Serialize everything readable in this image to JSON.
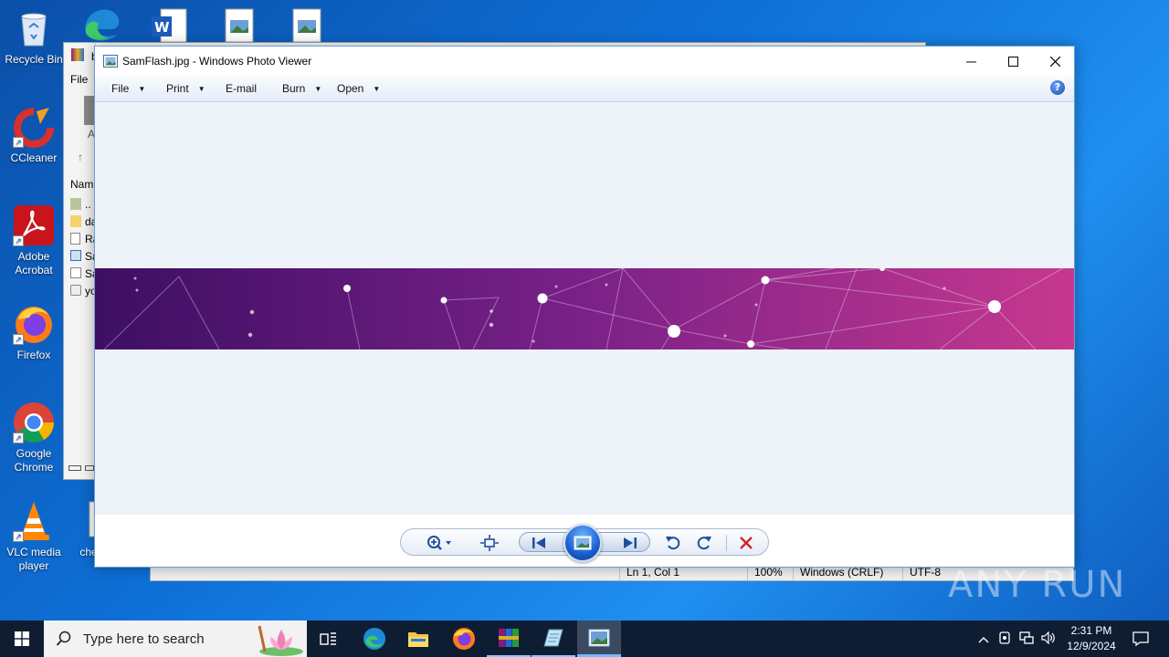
{
  "desktop": {
    "icons": [
      {
        "label": "Recycle Bin"
      },
      {
        "label": "CCleaner"
      },
      {
        "label": "Adobe Acrobat"
      },
      {
        "label": "Firefox"
      },
      {
        "label": "Google Chrome"
      },
      {
        "label": "VLC media player"
      },
      {
        "label": "chec"
      }
    ]
  },
  "background_explorer": {
    "menu_label": "File",
    "title_fragment": "b",
    "toolbar_fragment": "A",
    "column_header": "Nam",
    "rows": [
      "..",
      "da",
      "Ra",
      "Sa",
      "Sa",
      "yo"
    ]
  },
  "background_notepad": {
    "status": {
      "position": "Ln 1, Col 1",
      "zoom": "100%",
      "line_endings": "Windows (CRLF)",
      "encoding": "UTF-8"
    }
  },
  "photo_viewer": {
    "title": "SamFlash.jpg - Windows Photo Viewer",
    "menu": {
      "file": "File",
      "print": "Print",
      "email": "E-mail",
      "burn": "Burn",
      "open": "Open"
    },
    "help_label": "?",
    "controls": [
      "zoom",
      "actual-size",
      "previous",
      "slideshow",
      "next",
      "rotate-counterclockwise",
      "rotate-clockwise",
      "delete"
    ],
    "banner_colors": {
      "left": "#3d0f63",
      "mid": "#7a2188",
      "right": "#c7388f"
    }
  },
  "watermark": "ANY RUN",
  "taskbar": {
    "search_placeholder": "Type here to search",
    "clock_time": "2:31 PM",
    "clock_date": "12/9/2024",
    "apps": [
      "task-view",
      "edge",
      "file-explorer",
      "firefox",
      "winrar",
      "notepad",
      "photo-viewer"
    ]
  }
}
